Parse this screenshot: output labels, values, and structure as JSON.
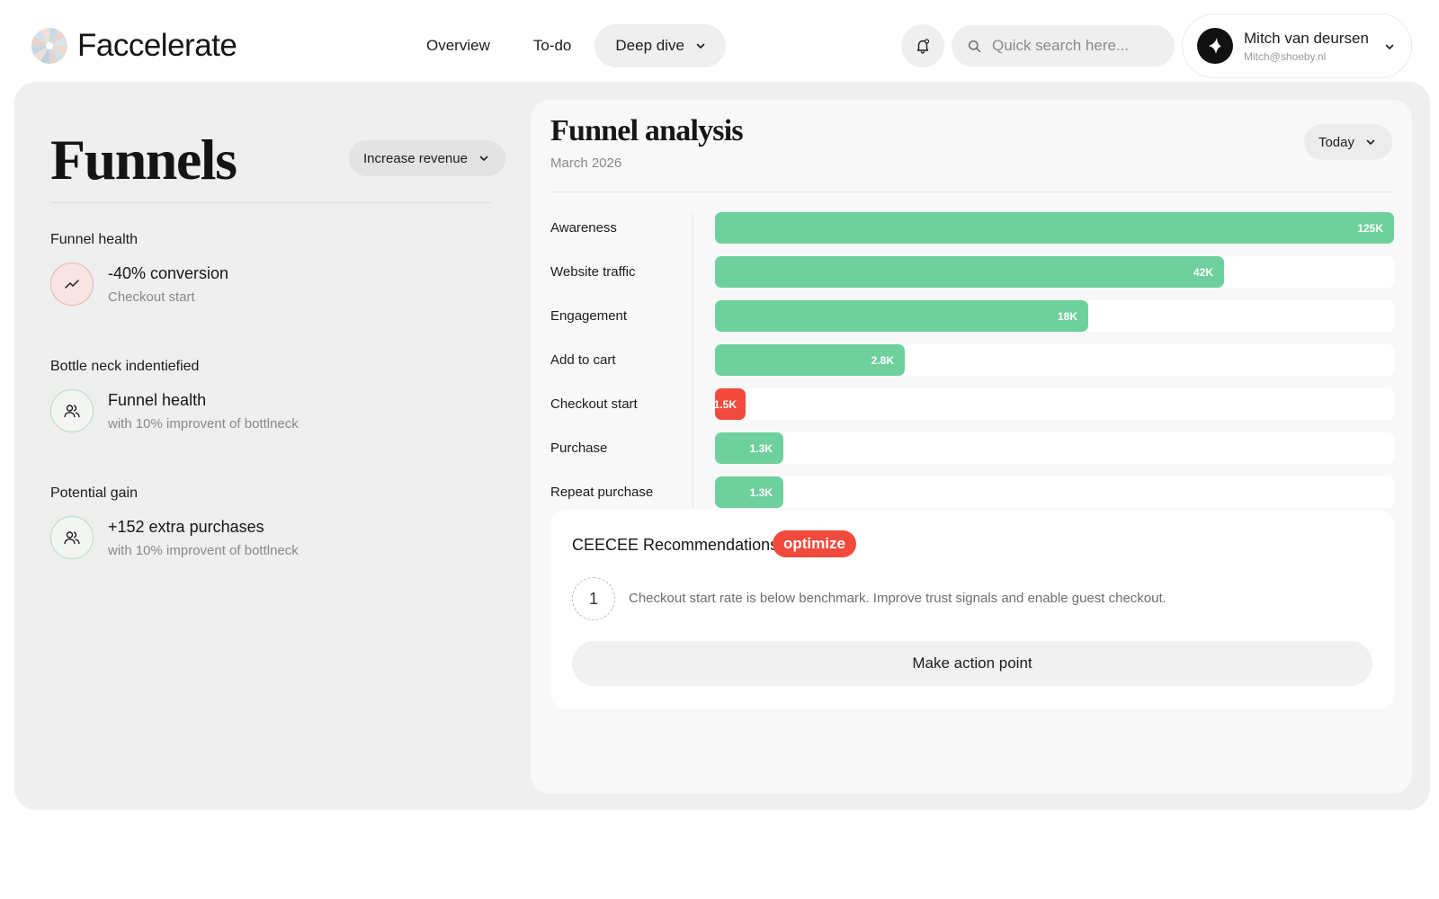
{
  "app": {
    "name": "Faccelerate"
  },
  "nav": {
    "items": [
      {
        "label": "Overview",
        "active": false
      },
      {
        "label": "To-do",
        "active": false
      },
      {
        "label": "Deep dive",
        "active": true
      }
    ]
  },
  "search": {
    "placeholder": "Quick search here..."
  },
  "user": {
    "name": "Mitch van deursen",
    "email": "Mitch@shoeby.nl"
  },
  "left": {
    "title": "Funnels",
    "goal_select": "Increase revenue",
    "metrics": [
      {
        "heading": "Funnel health",
        "value": "-40% conversion",
        "sub": "Checkout start",
        "icon": "trend-icon",
        "tone": "negative"
      },
      {
        "heading": "Bottle neck indentiefied",
        "value": "Funnel health",
        "sub": "with 10% improvent of bottlneck",
        "icon": "users-icon",
        "tone": "positive"
      },
      {
        "heading": "Potential gain",
        "value": "+152 extra purchases",
        "sub": "with 10% improvent of bottlneck",
        "icon": "users-icon",
        "tone": "positive"
      }
    ]
  },
  "analysis": {
    "title": "Funnel analysis",
    "subtitle": "March 2026",
    "period_select": "Today"
  },
  "chart_data": {
    "type": "bar",
    "orientation": "horizontal",
    "categories": [
      "Awareness",
      "Website traffic",
      "Engagement",
      "Add to cart",
      "Checkout start",
      "Purchase",
      "Repeat purchase"
    ],
    "values": [
      125000,
      42000,
      18000,
      2800,
      1500,
      1300,
      1300
    ],
    "labels": [
      "125K",
      "42K",
      "18K",
      "2.8K",
      "1.5K",
      "1.3K",
      "1.3K"
    ],
    "fill_fraction": [
      1.0,
      0.75,
      0.55,
      0.28,
      0.045,
      0.1,
      0.1
    ],
    "highlight": "Checkout start",
    "colors": {
      "normal": "#6ed19d",
      "bottleneck": "#f24a3d"
    }
  },
  "recommendations": {
    "title": "CEECEE Recommendations",
    "badge": "optimize",
    "items": [
      {
        "number": "1",
        "text": "Checkout start rate is below benchmark. Improve trust signals and enable guest checkout."
      }
    ],
    "action_label": "Make action point"
  },
  "colors": {
    "accent_green": "#6ed19d",
    "alert_red": "#f24a3d"
  }
}
